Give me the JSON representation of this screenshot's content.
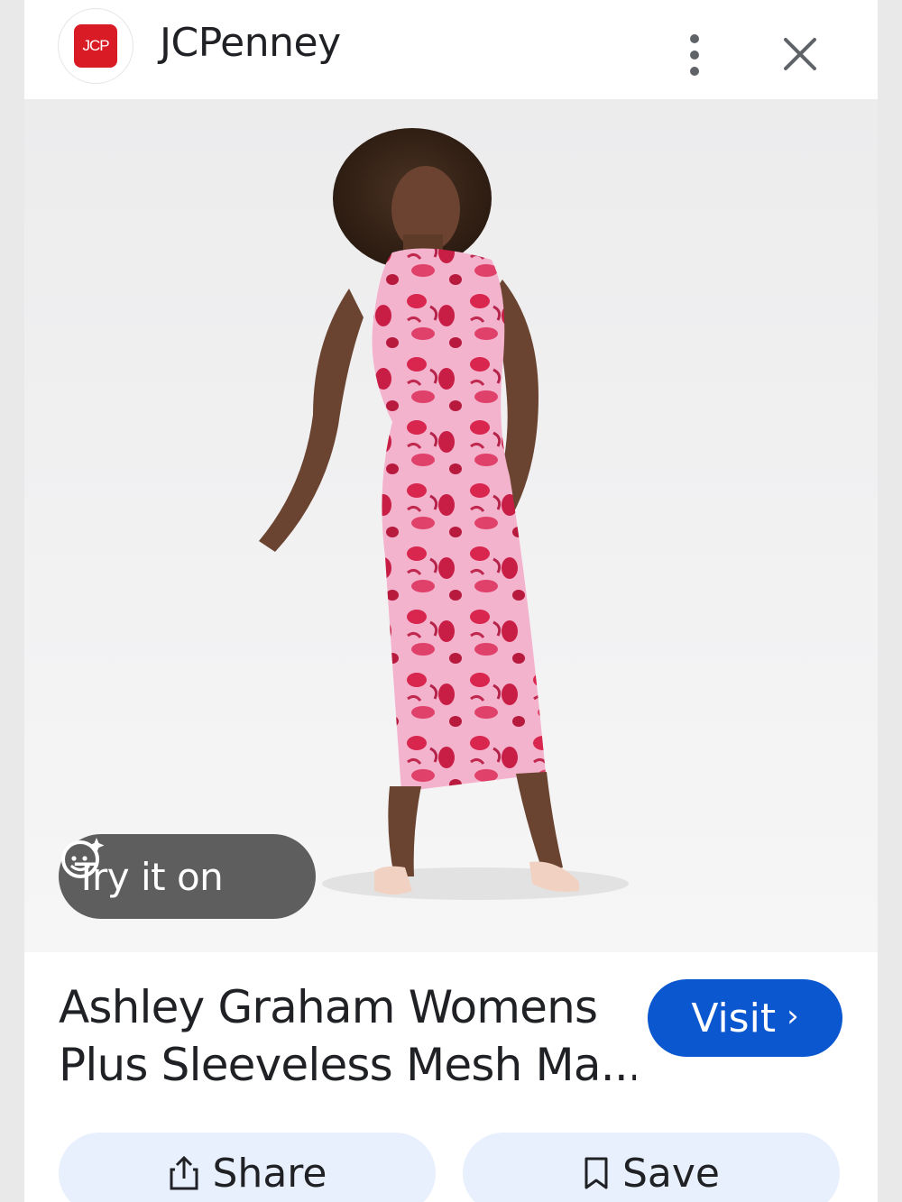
{
  "header": {
    "logo_text": "JCP",
    "brand_name": "JCPenney",
    "more_icon": "more-vert-icon",
    "close_icon": "close-icon"
  },
  "hero": {
    "try_on_label": "Try it on",
    "try_on_icon": "face-sparkle-icon"
  },
  "product": {
    "title_line1": "Ashley Graham Womens",
    "title_line2": "Plus Sleeveless Mesh Ma..."
  },
  "actions": {
    "visit_label": "Visit",
    "visit_chevron": "›",
    "share_label": "Share",
    "share_icon": "share-icon",
    "save_label": "Save",
    "save_icon": "bookmark-icon"
  },
  "colors": {
    "brand_red": "#d91b25",
    "visit_blue": "#0b57d0",
    "pill_bg": "#e8f0fe",
    "dress_pink": "#f2a6c4",
    "dress_red": "#d8264f"
  }
}
